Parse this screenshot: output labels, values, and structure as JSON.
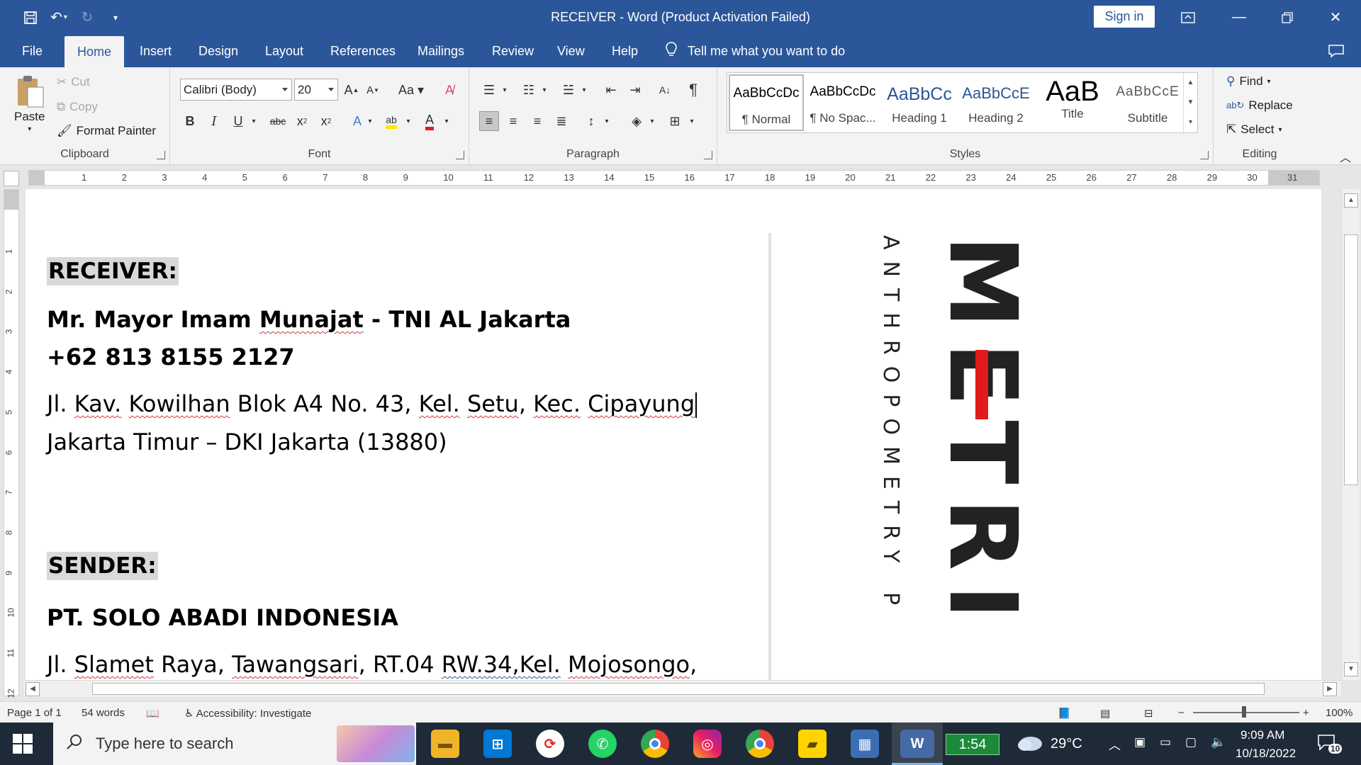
{
  "window": {
    "title": "RECEIVER  -  Word (Product Activation Failed)",
    "signin_label": "Sign in"
  },
  "tabs": [
    {
      "label": "File"
    },
    {
      "label": "Home"
    },
    {
      "label": "Insert"
    },
    {
      "label": "Design"
    },
    {
      "label": "Layout"
    },
    {
      "label": "References"
    },
    {
      "label": "Mailings"
    },
    {
      "label": "Review"
    },
    {
      "label": "View"
    },
    {
      "label": "Help"
    }
  ],
  "tellme": "Tell me what you want to do",
  "ribbon": {
    "clipboard": {
      "label": "Clipboard",
      "paste": "Paste",
      "cut": "Cut",
      "copy": "Copy",
      "format_painter": "Format Painter"
    },
    "font": {
      "label": "Font",
      "font_name": "Calibri (Body)",
      "font_size": "20"
    },
    "paragraph": {
      "label": "Paragraph"
    },
    "styles": {
      "label": "Styles",
      "items": [
        {
          "sample": "AaBbCcDc",
          "name": "¶ Normal"
        },
        {
          "sample": "AaBbCcDc",
          "name": "¶ No Spac..."
        },
        {
          "sample": "AaBbCc",
          "name": "Heading 1"
        },
        {
          "sample": "AaBbCcE",
          "name": "Heading 2"
        },
        {
          "sample": "AaB",
          "name": "Title"
        },
        {
          "sample": "AaBbCcE",
          "name": "Subtitle"
        }
      ]
    },
    "editing": {
      "label": "Editing",
      "find": "Find",
      "replace": "Replace",
      "select": "Select"
    }
  },
  "ruler": {
    "numbers": [
      "1",
      "2",
      "3",
      "4",
      "5",
      "6",
      "7",
      "8",
      "9",
      "10",
      "11",
      "12",
      "13",
      "14",
      "15",
      "16",
      "17",
      "18",
      "19",
      "20",
      "21",
      "22",
      "23",
      "24",
      "25",
      "26",
      "27",
      "28",
      "29",
      "30",
      "31"
    ]
  },
  "vruler": {
    "numbers": [
      "1",
      "2",
      "3",
      "4",
      "5",
      "6",
      "7",
      "8",
      "9",
      "10",
      "11",
      "12"
    ]
  },
  "document": {
    "receiver_heading": "RECEIVER:",
    "receiver_name_pre": "Mr. Mayor Imam ",
    "receiver_name_squig": "Munajat",
    "receiver_name_post": " - TNI AL Jakarta",
    "receiver_phone": "+62 813 8155 2127",
    "receiver_addr1_a": "Jl. ",
    "receiver_addr1_b": "Kav.",
    "receiver_addr1_c": " ",
    "receiver_addr1_d": "Kowilhan",
    "receiver_addr1_e": " Blok A4 No. 43, ",
    "receiver_addr1_f": "Kel.",
    "receiver_addr1_g": " ",
    "receiver_addr1_h": "Setu",
    "receiver_addr1_i": ", ",
    "receiver_addr1_j": "Kec.",
    "receiver_addr1_k": " ",
    "receiver_addr1_l": "Cipayung",
    "receiver_addr2": "Jakarta Timur – DKI Jakarta (13880)",
    "sender_heading": "SENDER:",
    "sender_name": "PT. SOLO ABADI INDONESIA",
    "sender_addr_a": "Jl. ",
    "sender_addr_b": "Slamet",
    "sender_addr_c": " Raya, ",
    "sender_addr_d": "Tawangsari",
    "sender_addr_e": ", RT.04 ",
    "sender_addr_f": "RW.34,Kel.",
    "sender_addr_g": " ",
    "sender_addr_h": "Mojosongo",
    "sender_addr_i": ","
  },
  "logo": {
    "main": "METRI",
    "sub": "ANTHROPOMETRY P"
  },
  "status": {
    "page": "Page 1 of 1",
    "words": "54 words",
    "accessibility": "Accessibility: Investigate",
    "zoom": "100%"
  },
  "taskbar": {
    "search_placeholder": "Type here to search",
    "timer": "1:54",
    "temperature": "29°C",
    "time": "9:09 AM",
    "date": "10/18/2022",
    "notifications": "10"
  }
}
